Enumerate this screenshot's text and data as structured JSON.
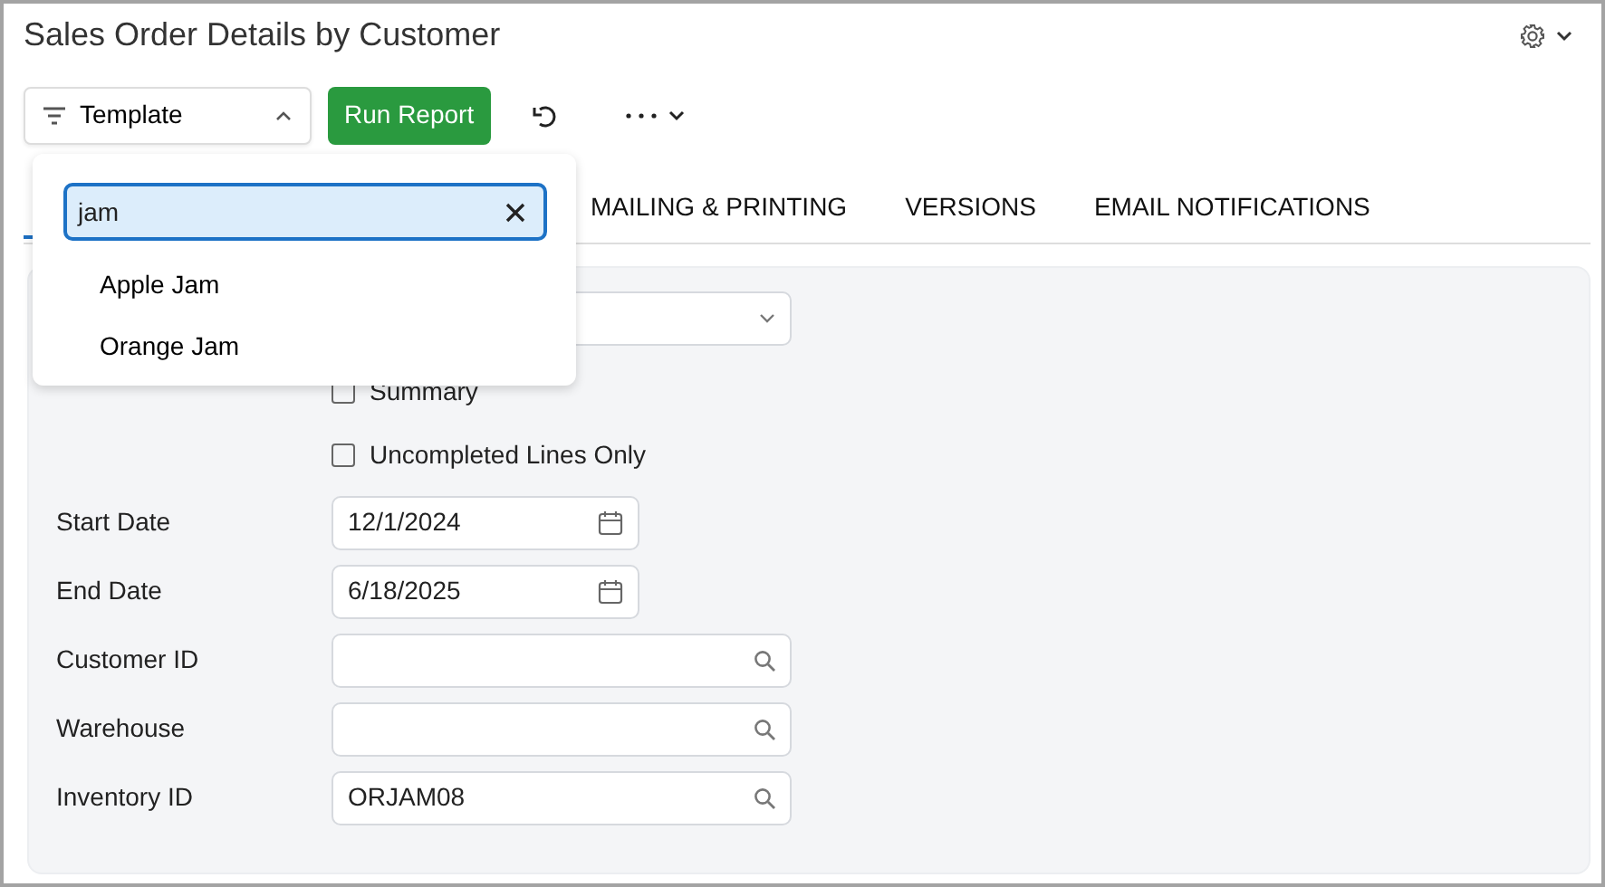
{
  "window": {
    "title": "Sales Order Details by Customer"
  },
  "toolbar": {
    "template": {
      "label": "Template",
      "expanded": true
    },
    "run_button": "Run Report"
  },
  "template_menu": {
    "search": {
      "value": "jam"
    },
    "items": [
      {
        "label": "Apple Jam"
      },
      {
        "label": "Orange Jam"
      }
    ]
  },
  "tabs": [
    {
      "selected": true
    },
    {
      "label": "MAILING & PRINTING",
      "selected": false
    },
    {
      "label": "VERSIONS",
      "selected": false
    },
    {
      "label": "EMAIL NOTIFICATIONS",
      "selected": false
    }
  ],
  "form": {
    "rows": [
      {
        "kind": "select"
      },
      {
        "kind": "checkbox",
        "label": "Summary",
        "checked": false
      },
      {
        "kind": "checkbox",
        "label": "Uncompleted Lines Only",
        "checked": false
      },
      {
        "kind": "date",
        "label": "Start Date",
        "value": "12/1/2024"
      },
      {
        "kind": "date",
        "label": "End Date",
        "value": "6/18/2025"
      },
      {
        "kind": "lookup",
        "label": "Customer ID"
      },
      {
        "kind": "lookup",
        "label": "Warehouse"
      },
      {
        "kind": "lookup",
        "label": "Inventory ID",
        "value": "ORJAM08"
      }
    ]
  }
}
